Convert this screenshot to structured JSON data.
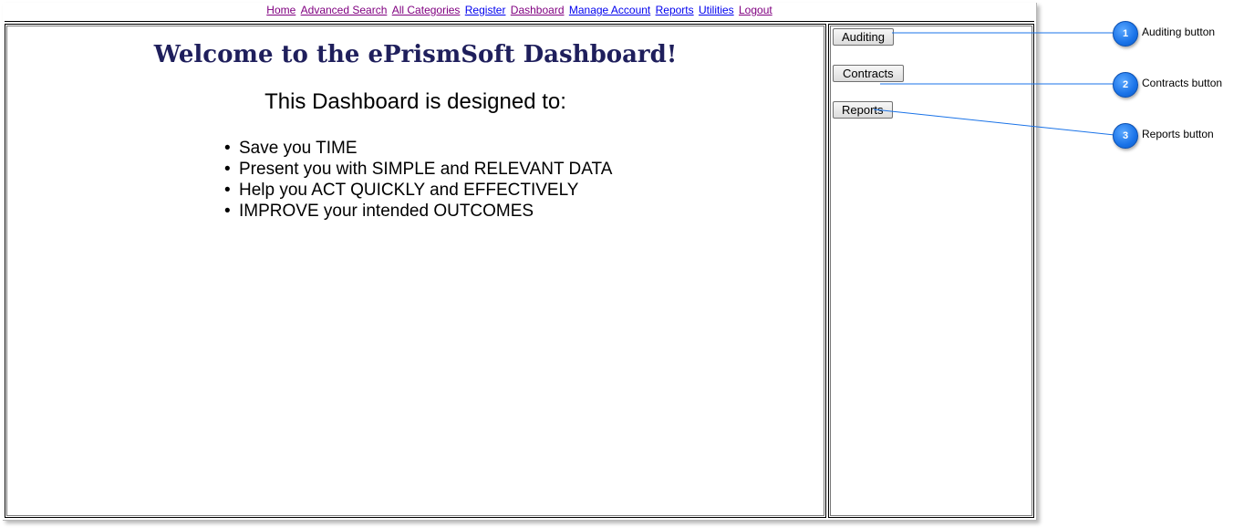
{
  "nav": {
    "links": [
      {
        "label": "Home",
        "visited": true
      },
      {
        "label": "Advanced Search",
        "visited": true
      },
      {
        "label": "All Categories",
        "visited": true
      },
      {
        "label": "Register",
        "visited": false
      },
      {
        "label": "Dashboard",
        "visited": true
      },
      {
        "label": "Manage Account",
        "visited": false
      },
      {
        "label": "Reports",
        "visited": false
      },
      {
        "label": "Utilities",
        "visited": false
      },
      {
        "label": "Logout",
        "visited": true
      }
    ]
  },
  "main": {
    "title": "Welcome to the ePrismSoft Dashboard!",
    "subtitle": "This Dashboard is designed to:",
    "bullets": [
      "Save you TIME",
      "Present you with SIMPLE and RELEVANT DATA",
      "Help you ACT QUICKLY and EFFECTIVELY",
      "IMPROVE your intended OUTCOMES"
    ]
  },
  "sidebar": {
    "buttons": [
      "Auditing",
      "Contracts",
      "Reports"
    ]
  },
  "callouts": [
    {
      "number": "1",
      "label": "Auditing button"
    },
    {
      "number": "2",
      "label": "Contracts button"
    },
    {
      "number": "3",
      "label": "Reports button"
    }
  ],
  "colors": {
    "title": "#1f1f5c",
    "link_visited": "#800080",
    "link_unvisited": "#0000ee",
    "callout_badge": "#1a73e8",
    "callout_line": "#1a73e8"
  }
}
